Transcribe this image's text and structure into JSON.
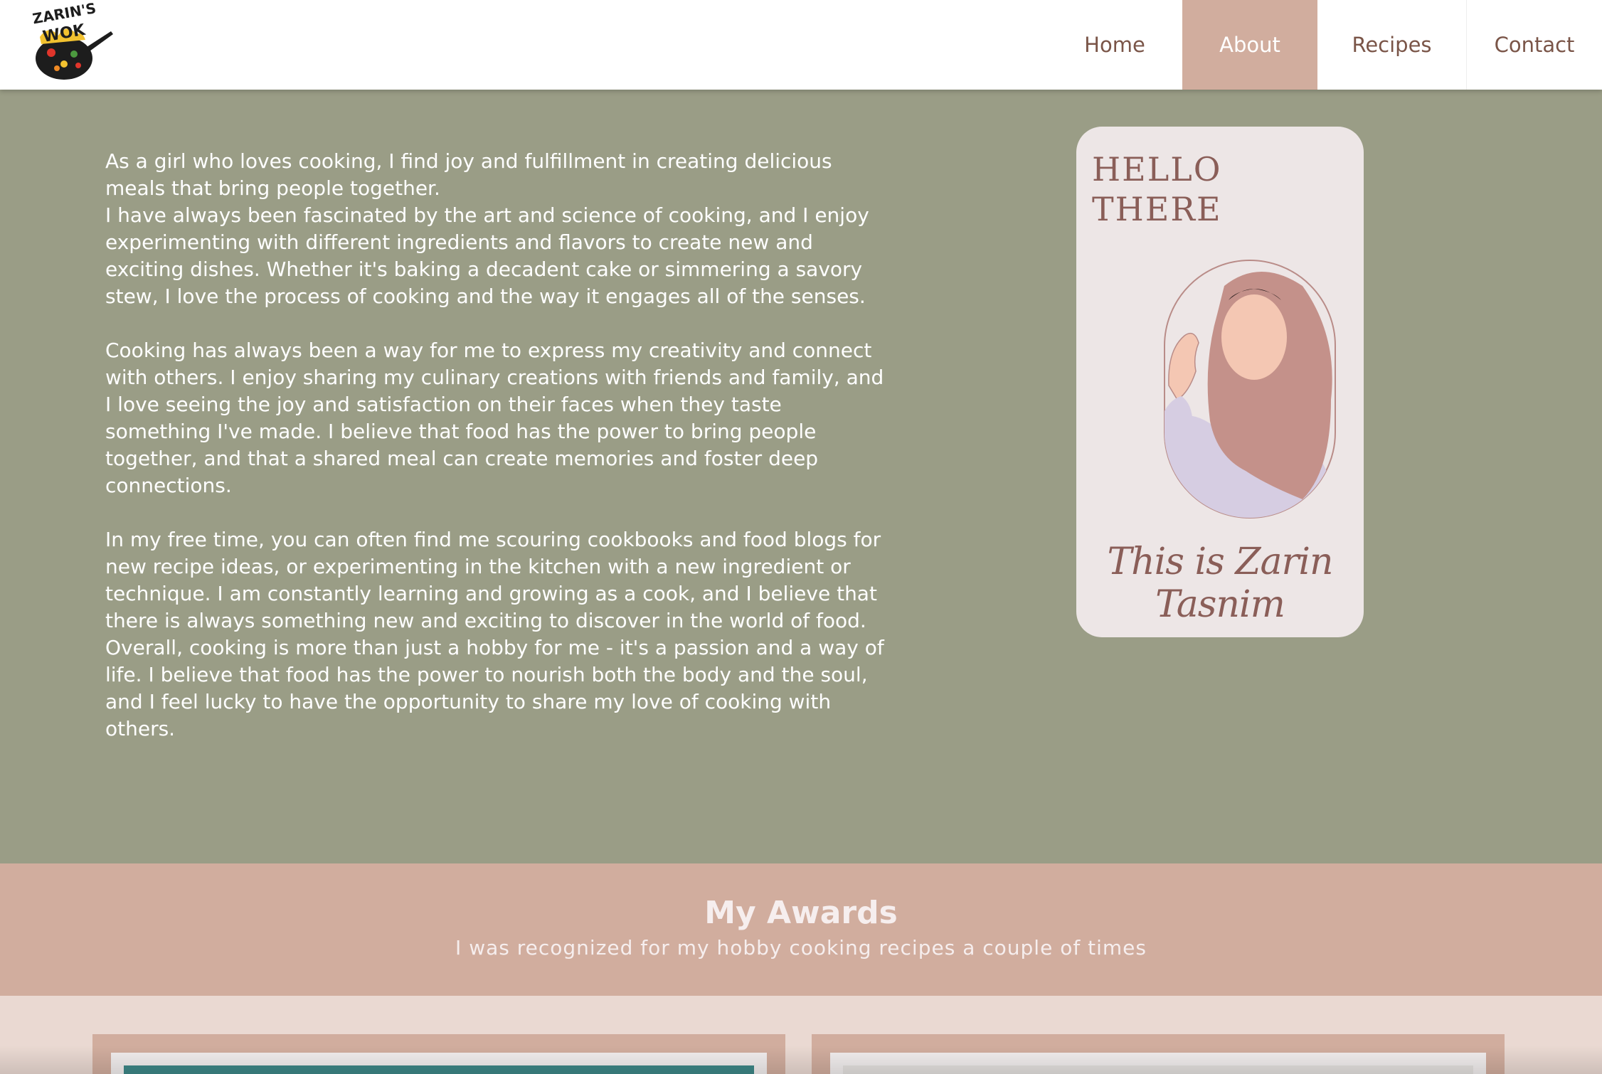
{
  "header": {
    "logo_text_line1": "ZARIN'S",
    "logo_text_line2": "WOK",
    "nav": {
      "home": "Home",
      "about": "About",
      "recipes": "Recipes",
      "contact": "Contact"
    },
    "active_nav": "About"
  },
  "about": {
    "paragraphs": [
      "As a girl who loves cooking, I find joy and fulfillment in creating delicious meals that bring people together.",
      "I have always been fascinated by the art and science of cooking, and I enjoy experimenting with different ingredients and flavors to create new and exciting dishes. Whether it's baking a decadent cake or simmering a savory stew, I love the process of cooking and the way it engages all of the senses.",
      "Cooking has always been a way for me to express my creativity and connect with others. I enjoy sharing my culinary creations with friends and family, and I love seeing the joy and satisfaction on their faces when they taste something I've made. I believe that food has the power to bring people together, and that a shared meal can create memories and foster deep connections.",
      "In my free time, you can often find me scouring cookbooks and food blogs for new recipe ideas, or experimenting in the kitchen with a new ingredient or technique. I am constantly learning and growing as a cook, and I believe that there is always something new and exciting to discover in the world of food. Overall, cooking is more than just a hobby for me - it's a passion and a way of life. I believe that food has the power to nourish both the body and the soul, and I feel lucky to have the opportunity to share my love of cooking with others."
    ],
    "card": {
      "hello_line1": "HELLO",
      "hello_line2": "THERE",
      "signature": "This is Zarin Tasnim"
    }
  },
  "awards": {
    "title": "My Awards",
    "subtitle": "I was recognized for my hobby cooking recipes a couple of times"
  },
  "colors": {
    "sage": "#9a9d86",
    "dusty_rose": "#d1ad9e",
    "blush": "#ead9d2",
    "card_bg": "#ede6e6",
    "brown_text": "#7a5548"
  }
}
